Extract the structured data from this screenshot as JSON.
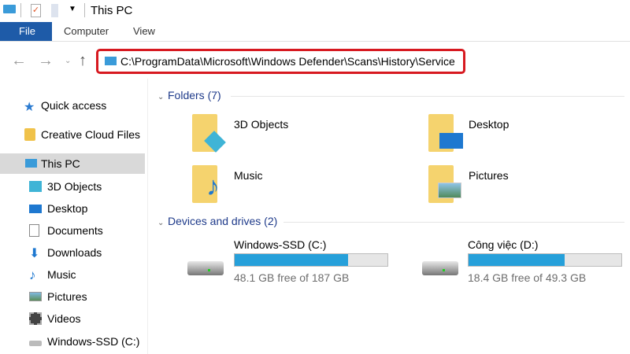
{
  "title": "This PC",
  "ribbon": {
    "tabs": [
      "File",
      "Computer",
      "View"
    ]
  },
  "address": {
    "path": "C:\\ProgramData\\Microsoft\\Windows Defender\\Scans\\History\\Service"
  },
  "sidebar": {
    "items": [
      {
        "label": "Quick access",
        "icon": "star-icon"
      },
      {
        "label": "Creative Cloud Files",
        "icon": "creative-cloud-icon"
      },
      {
        "label": "This PC",
        "icon": "computer-icon",
        "selected": true
      },
      {
        "label": "3D Objects",
        "icon": "cube-icon"
      },
      {
        "label": "Desktop",
        "icon": "desktop-icon"
      },
      {
        "label": "Documents",
        "icon": "document-icon"
      },
      {
        "label": "Downloads",
        "icon": "download-icon"
      },
      {
        "label": "Music",
        "icon": "music-icon"
      },
      {
        "label": "Pictures",
        "icon": "picture-icon"
      },
      {
        "label": "Videos",
        "icon": "video-icon"
      },
      {
        "label": "Windows-SSD (C:)",
        "icon": "drive-icon"
      }
    ]
  },
  "folders": {
    "header": "Folders (7)",
    "items": [
      "3D Objects",
      "Desktop",
      "Music",
      "Pictures"
    ]
  },
  "drives": {
    "header": "Devices and drives (2)",
    "items": [
      {
        "name": "Windows-SSD (C:)",
        "free": "48.1 GB free of 187 GB",
        "used_fraction": 0.74
      },
      {
        "name": "Công việc (D:)",
        "free": "18.4 GB free of 49.3 GB",
        "used_fraction": 0.63
      }
    ]
  },
  "colors": {
    "accent": "#1e5ba8",
    "highlight": "#d71920",
    "bar": "#26a0da"
  }
}
